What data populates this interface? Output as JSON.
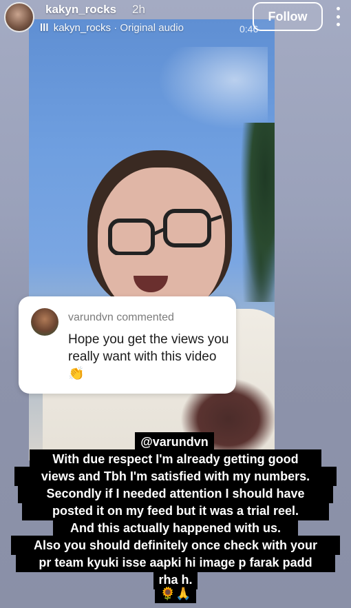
{
  "header": {
    "username": "kakyn_rocks",
    "time": "2h",
    "audio_bars": "lll",
    "audio_user": "kakyn_rocks",
    "audio_source": "· Original audio",
    "duration": "0:46",
    "follow_label": "Follow"
  },
  "comment": {
    "user": "varundvn",
    "action": "commented",
    "text": "Hope you get the views you really want with this video 👏"
  },
  "caption": {
    "mention": "@varundvn",
    "lines": [
      "With due respect I'm already getting good",
      "views and Tbh I'm satisfied with my numbers.",
      "Secondly if I needed attention I should have",
      "posted it on my feed but it was a trial reel.",
      "And this actually happened with us.",
      "Also you should definitely once check with your",
      "pr team kyuki isse aapki hi image p farak padd",
      "rha h.",
      "🌻🙏"
    ]
  },
  "colors": {
    "caption_bg": "#000000",
    "card_bg": "#ffffff",
    "text_white": "#ffffff"
  }
}
